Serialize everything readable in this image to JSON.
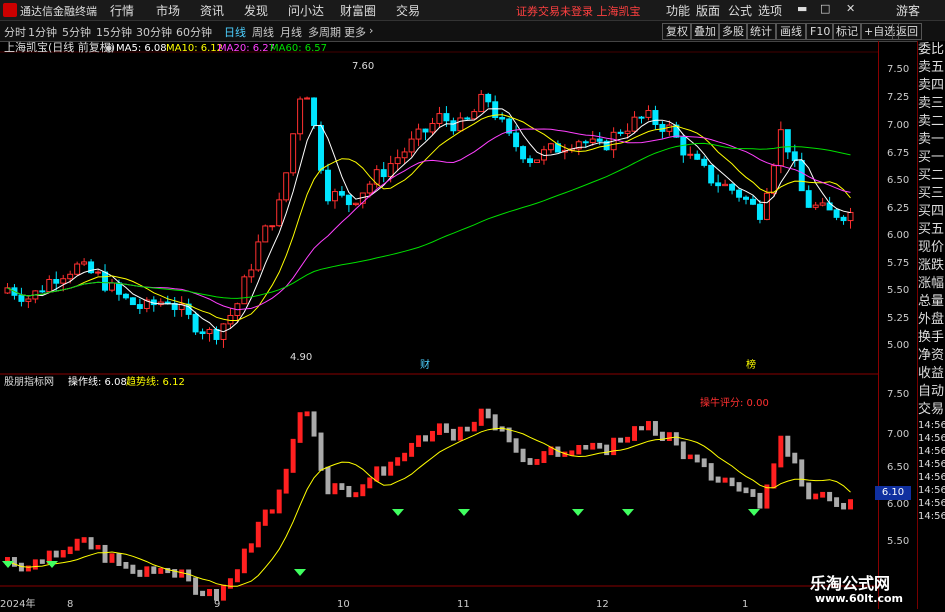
{
  "app": {
    "title": "通达信金融终端",
    "warning": "证券交易未登录 上海凯宝",
    "user": "游客"
  },
  "menus": [
    "行情",
    "市场",
    "资讯",
    "发现",
    "问小达",
    "财富圈",
    "交易"
  ],
  "right_menus": [
    "功能",
    "版面",
    "公式",
    "选项"
  ],
  "periods": [
    "分时",
    "1分钟",
    "5分钟",
    "15分钟",
    "30分钟",
    "60分钟",
    "日线",
    "周线",
    "月线",
    "多周期",
    "更多"
  ],
  "active_period": "日线",
  "right_buttons": [
    "复权",
    "叠加",
    "多股",
    "统计",
    "画线",
    "F10",
    "标记",
    "+自选",
    "返回"
  ],
  "main_chart": {
    "title": "上海凯宝(日线 前复权)",
    "ma5": "MA5: 6.08",
    "ma10": "MA10: 6.12",
    "ma20": "MA20: 6.27",
    "ma60": "MA60: 6.57",
    "high_label": "7.60",
    "low_label": "4.90",
    "ticks": [
      "7.50",
      "7.25",
      "7.00",
      "6.75",
      "6.50",
      "6.25",
      "6.00",
      "5.75",
      "5.50",
      "5.25",
      "5.00"
    ],
    "event_markers": [
      "财",
      "榜"
    ]
  },
  "sub_chart": {
    "title": "股朋指标网",
    "op_line": "操作线: 6.08",
    "trend_line": "趋势线: 6.12",
    "score": "操牛评分: 0.00",
    "ticks": [
      "7.50",
      "7.00",
      "6.50",
      "6.00",
      "5.50"
    ],
    "price_box": "6.10",
    "signal": "撬"
  },
  "x_axis": [
    "2024年",
    "8",
    "9",
    "10",
    "11",
    "12",
    "1"
  ],
  "side_panel": [
    "委比",
    "卖五",
    "卖四",
    "卖三",
    "卖二",
    "卖一",
    "买一",
    "买二",
    "买三",
    "买四",
    "买五",
    "现价",
    "涨跌",
    "涨幅",
    "总量",
    "外盘",
    "换手",
    "净资",
    "收益",
    "自动",
    "交易",
    "14:56",
    "14:56",
    "14:56",
    "14:56",
    "14:56",
    "14:56",
    "14:56",
    "14:56"
  ],
  "watermark": {
    "title": "乐淘公式网",
    "url": "www.60lt.com"
  },
  "colors": {
    "up": "#ff3030",
    "down": "#00e5ff",
    "ma5": "#ffffff",
    "ma10": "#ffff00",
    "ma20": "#ff40ff",
    "ma60": "#00e000"
  }
}
